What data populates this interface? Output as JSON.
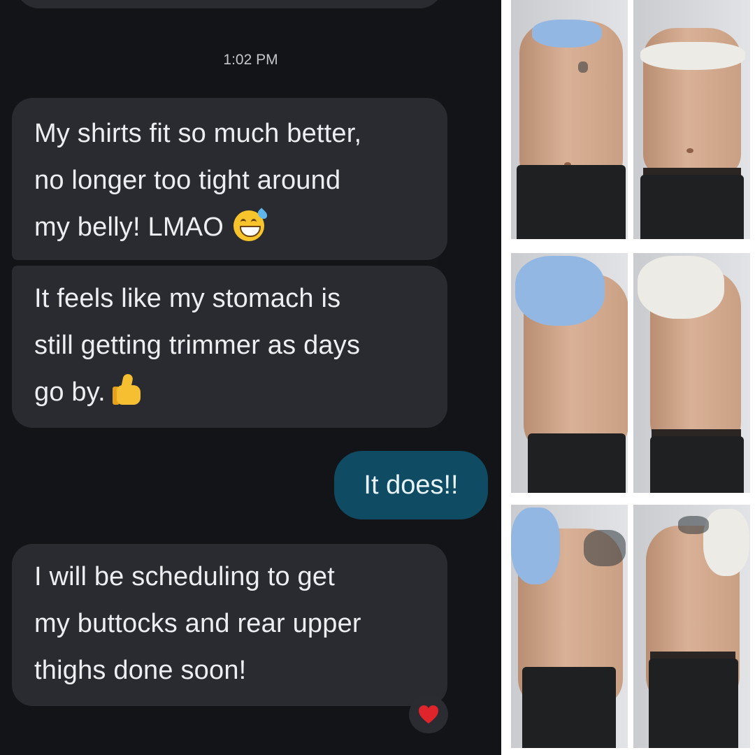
{
  "conversation": {
    "timestamp": "1:02 PM",
    "received_messages": [
      {
        "lines": [
          "My shirts fit so much better,",
          "no longer too tight around",
          "my belly! LMAO"
        ],
        "emoji": "grinning-sweat-emoji"
      },
      {
        "lines": [
          "It feels like my stomach is",
          "still getting trimmer as days",
          "go by."
        ],
        "emoji": "thumbs-up-emoji"
      },
      {
        "lines": [
          "I will be scheduling to get",
          "my buttocks and rear upper",
          "thighs done soon!"
        ],
        "emoji": ""
      }
    ],
    "sent_message": "It does!!",
    "reaction": "red-heart-icon",
    "colors": {
      "background": "#131418",
      "received_bubble": "#2a2b30",
      "sent_bubble": "#0f4c63",
      "text": "#eceef1"
    }
  },
  "photos": [
    {
      "row": "front",
      "column": "before",
      "shirt_color": "light blue"
    },
    {
      "row": "front",
      "column": "after",
      "shirt_color": "white"
    },
    {
      "row": "side-right",
      "column": "before",
      "shirt_color": "light blue"
    },
    {
      "row": "side-right",
      "column": "after",
      "shirt_color": "white"
    },
    {
      "row": "side-left",
      "column": "before",
      "shirt_color": "light blue"
    },
    {
      "row": "side-left",
      "column": "after",
      "shirt_color": "white"
    }
  ]
}
